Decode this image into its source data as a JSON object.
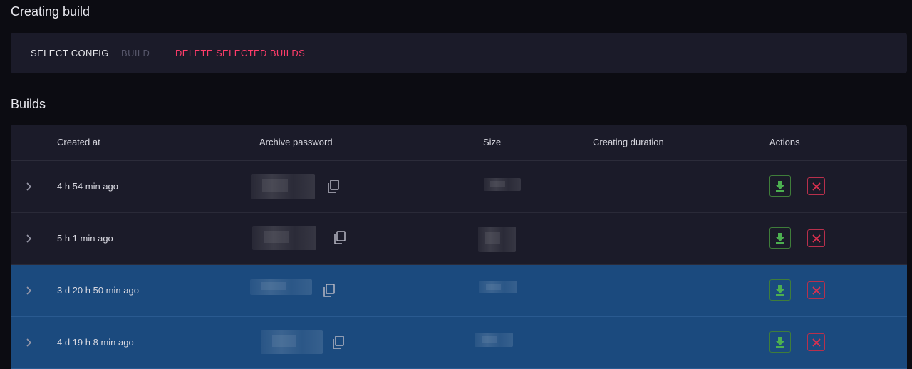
{
  "header": {
    "title": "Creating build"
  },
  "toolbar": {
    "select_config_label": "SELECT CONFIG",
    "build_label": "BUILD",
    "delete_selected_label": "DELETE SELECTED BUILDS",
    "delete_color": "#ff3d6a"
  },
  "builds": {
    "title": "Builds",
    "columns": [
      "Created at",
      "Archive password",
      "Size",
      "Creating duration",
      "Actions"
    ],
    "rows": [
      {
        "created_at": "4 h 54 min ago",
        "selected": false
      },
      {
        "created_at": "5 h 1 min ago",
        "selected": false
      },
      {
        "created_at": "3 d 20 h 50 min ago",
        "selected": true
      },
      {
        "created_at": "4 d 19 h 8 min ago",
        "selected": true
      }
    ],
    "icons": {
      "expand": "chevron-right-icon",
      "copy": "copy-icon",
      "download": "download-icon",
      "delete": "close-icon"
    },
    "colors": {
      "selected_row": "#1b4a7e",
      "download": "#4caf50",
      "delete": "#e0304f"
    }
  }
}
